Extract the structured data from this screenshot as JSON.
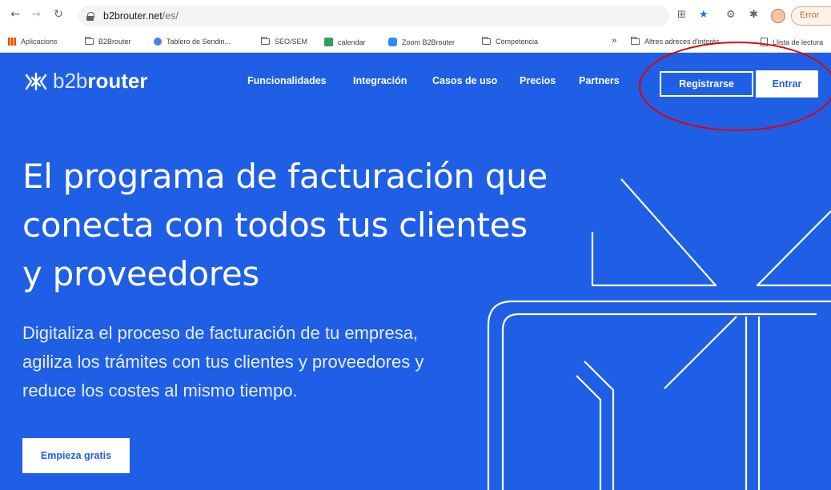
{
  "browser": {
    "url_host": "b2brouter.net",
    "url_path": "/es/",
    "error_label": "Error",
    "icons": [
      "back-arrow-icon",
      "forward-arrow-icon",
      "reload-icon",
      "lock-icon",
      "translate-icon",
      "star-icon",
      "extension-icon",
      "puzzle-icon",
      "avatar"
    ]
  },
  "bookmarks": [
    {
      "label": "Aplicacions",
      "icon": "apps-icon"
    },
    {
      "label": "B2Brouter",
      "icon": "folder-icon"
    },
    {
      "label": "Tablero de Sendin...",
      "icon": "site-icon"
    },
    {
      "label": "SEO/SEM",
      "icon": "folder-icon"
    },
    {
      "label": "calendar",
      "icon": "calendar-icon"
    },
    {
      "label": "Zoom B2Brouter",
      "icon": "zoom-icon"
    },
    {
      "label": "Competencia",
      "icon": "folder-icon"
    },
    {
      "label": "»",
      "icon": ""
    },
    {
      "label": "Altres adreces d'interès",
      "icon": "folder-icon"
    },
    {
      "label": "Llista de lectura",
      "icon": "reading-list-icon"
    }
  ],
  "site": {
    "logo_light": "b2b",
    "logo_bold": "router",
    "nav": [
      "Funcionalidades",
      "Integración",
      "Casos de uso",
      "Precios",
      "Partners"
    ],
    "register_label": "Registrarse",
    "login_label": "Entrar",
    "hero_title_lines": [
      "El programa de facturación que",
      "conecta con todos tus clientes",
      "y proveedores"
    ],
    "hero_sub_lines": [
      "Digitaliza el proceso de facturación de tu empresa,",
      "agiliza los trámites con tus clientes y proveedores y",
      "reduce los costes al mismo tiempo."
    ],
    "cta_label": "Empieza gratis"
  },
  "colors": {
    "brand_blue": "#1f5fe6",
    "annotation_red": "#e00000"
  }
}
